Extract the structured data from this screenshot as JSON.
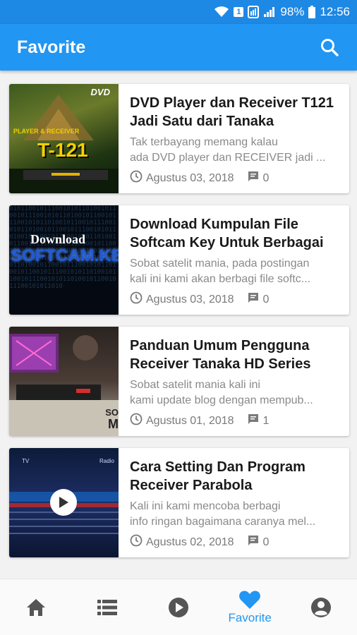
{
  "status_bar": {
    "sim_badge": "1",
    "battery": "98%",
    "time": "12:56"
  },
  "app_bar": {
    "title": "Favorite",
    "search_icon": "search-icon"
  },
  "posts": [
    {
      "title": "DVD Player dan Receiver T121 Jadi Satu dari Tanaka",
      "excerpt_lines": [
        "Tak terbayang memang kalau",
        "ada DVD player dan RECEIVER jadi ..."
      ],
      "date": "Agustus 03, 2018",
      "comments": "0",
      "thumb_text": [
        "DVD",
        "PLAYER & RECEIVER",
        "T-121"
      ]
    },
    {
      "title": "Download Kumpulan File Softcam Key Untuk Berbagai",
      "excerpt_lines": [
        "Sobat satelit mania, pada postingan",
        "kali ini kami akan berbagi file softc..."
      ],
      "date": "Agustus 03, 2018",
      "comments": "0",
      "thumb_text": [
        "Download",
        "SOFTCAM.KEY"
      ]
    },
    {
      "title": "Panduan Umum Pengguna Receiver Tanaka HD Series",
      "excerpt_lines": [
        "Sobat satelit mania kali ini",
        "kami update blog dengan mempub..."
      ],
      "date": "Agustus 01, 2018",
      "comments": "1",
      "thumb_text": [
        "SO",
        "M"
      ]
    },
    {
      "title": "Cara Setting Dan Program Receiver Parabola",
      "excerpt_lines": [
        "Kali ini kami mencoba berbagi",
        "info ringan bagaimana caranya mel..."
      ],
      "date": "Agustus 02, 2018",
      "comments": "0",
      "thumb_text": [
        "TV",
        "Radio"
      ]
    }
  ],
  "bottom_nav": {
    "items": [
      {
        "icon": "home-icon"
      },
      {
        "icon": "list-icon"
      },
      {
        "icon": "play-icon"
      },
      {
        "icon": "heart-icon",
        "label": "Favorite",
        "active": true
      },
      {
        "icon": "account-icon"
      }
    ]
  },
  "colors": {
    "primary": "#2196f3",
    "status_bar": "#1e88e5",
    "nav_inactive": "#555555"
  }
}
